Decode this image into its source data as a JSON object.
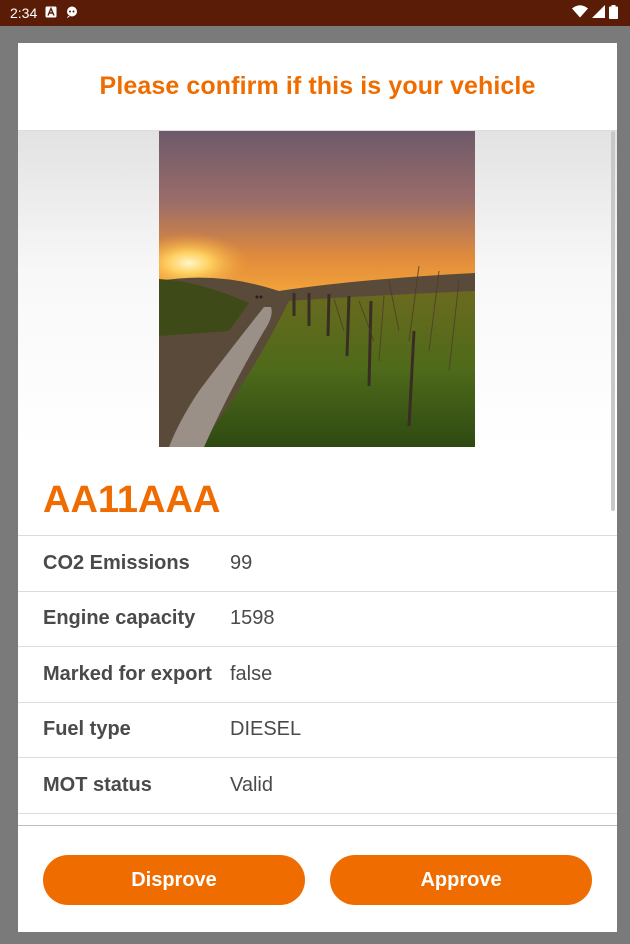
{
  "status_bar": {
    "time": "2:34",
    "icons": [
      "a-notification-icon",
      "chat-notification-icon",
      "wifi-icon",
      "signal-icon",
      "battery-icon"
    ]
  },
  "dialog": {
    "title": "Please confirm if this is your vehicle",
    "vehicle_image": "sunset-vineyard-path-photo",
    "registration": "AA11AAA",
    "details": [
      {
        "label": "CO2 Emissions",
        "value": "99"
      },
      {
        "label": "Engine capacity",
        "value": "1598"
      },
      {
        "label": "Marked for export",
        "value": "false"
      },
      {
        "label": "Fuel type",
        "value": "DIESEL"
      },
      {
        "label": "MOT status",
        "value": "Valid"
      }
    ],
    "buttons": {
      "disprove": "Disprove",
      "approve": "Approve"
    }
  },
  "colors": {
    "accent": "#ef6c00",
    "status_bar": "#5a1c06",
    "scrim": "#7a7a7a",
    "text": "#4a4a4a"
  }
}
